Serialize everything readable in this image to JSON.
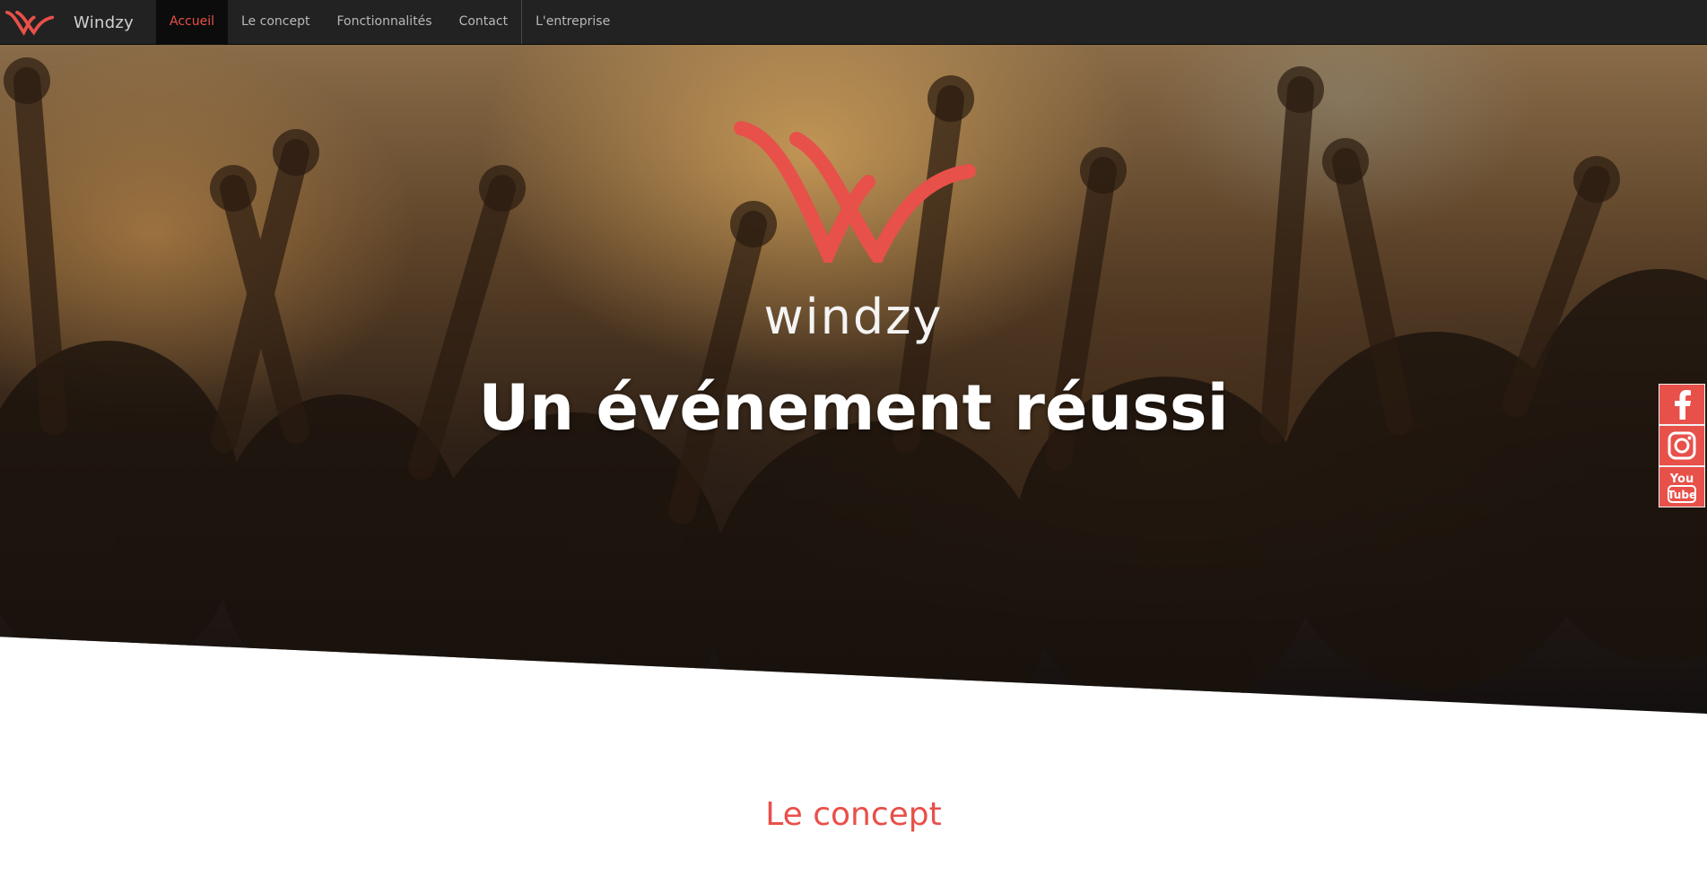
{
  "brand": {
    "name": "Windzy",
    "logo_icon": "windzy-w-logo-icon",
    "accent_color": "#e8504a"
  },
  "nav": {
    "items": [
      {
        "label": "Accueil",
        "active": true
      },
      {
        "label": "Le concept",
        "active": false
      },
      {
        "label": "Fonctionnalités",
        "active": false
      },
      {
        "label": "Contact",
        "active": false
      },
      {
        "label": "L'entreprise",
        "active": false
      }
    ]
  },
  "hero": {
    "logo_icon": "windzy-w-logo-icon",
    "wordmark": "windzy",
    "headline": "Un événement réussi"
  },
  "social": {
    "items": [
      {
        "icon": "facebook-icon"
      },
      {
        "icon": "instagram-icon"
      },
      {
        "icon": "youtube-icon",
        "text_top": "You",
        "text_bottom": "Tube"
      }
    ]
  },
  "concept": {
    "title": "Le concept"
  }
}
